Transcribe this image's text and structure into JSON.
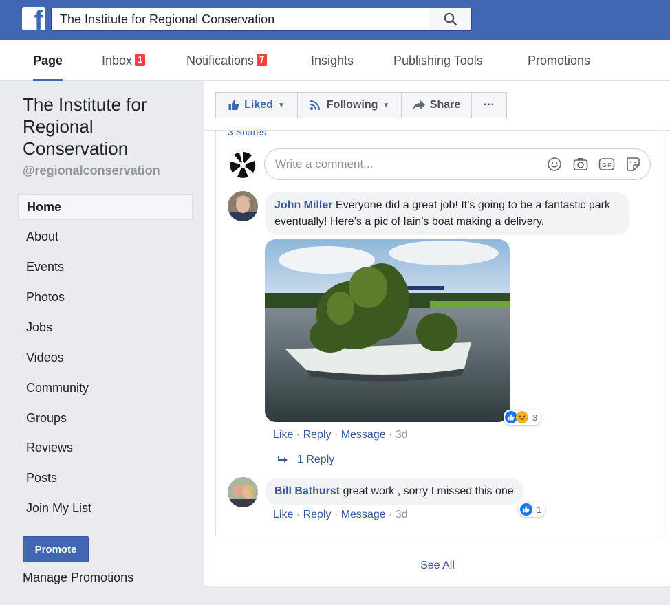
{
  "topbar": {
    "search_value": "The Institute for Regional Conservation",
    "colors": {
      "brand": "#4267b2"
    }
  },
  "tabs": [
    {
      "label": "Page",
      "active": true
    },
    {
      "label": "Inbox",
      "badge": "1"
    },
    {
      "label": "Notifications",
      "badge": "7"
    },
    {
      "label": "Insights"
    },
    {
      "label": "Publishing Tools"
    },
    {
      "label": "Promotions"
    }
  ],
  "sidebar": {
    "page_name": "The Institute for Regional Conservation",
    "handle": "@regionalconservation",
    "items": [
      {
        "label": "Home",
        "active": true
      },
      {
        "label": "About"
      },
      {
        "label": "Events"
      },
      {
        "label": "Photos"
      },
      {
        "label": "Jobs"
      },
      {
        "label": "Videos"
      },
      {
        "label": "Community"
      },
      {
        "label": "Groups"
      },
      {
        "label": "Reviews"
      },
      {
        "label": "Posts"
      },
      {
        "label": "Join My List"
      }
    ],
    "promote_label": "Promote",
    "manage_promotions": "Manage Promotions"
  },
  "action_bar": {
    "liked": "Liked",
    "following": "Following",
    "share": "Share",
    "more": "···"
  },
  "post": {
    "shares": "3 Shares",
    "comment_placeholder": "Write a comment...",
    "comments": [
      {
        "author": "John Miller",
        "text": "Everyone did a great job! It’s going to be a fantastic park eventually! Here’s a pic of Iain’s boat making a delivery.",
        "reactions_count": "3",
        "actions": {
          "like": "Like",
          "reply": "Reply",
          "message": "Message",
          "time": "3d"
        },
        "replies_label": "1 Reply"
      },
      {
        "author": "Bill Bathurst",
        "text": "great work , sorry I missed this one",
        "reactions_count": "1",
        "actions": {
          "like": "Like",
          "reply": "Reply",
          "message": "Message",
          "time": "3d"
        }
      }
    ],
    "see_all": "See All"
  }
}
